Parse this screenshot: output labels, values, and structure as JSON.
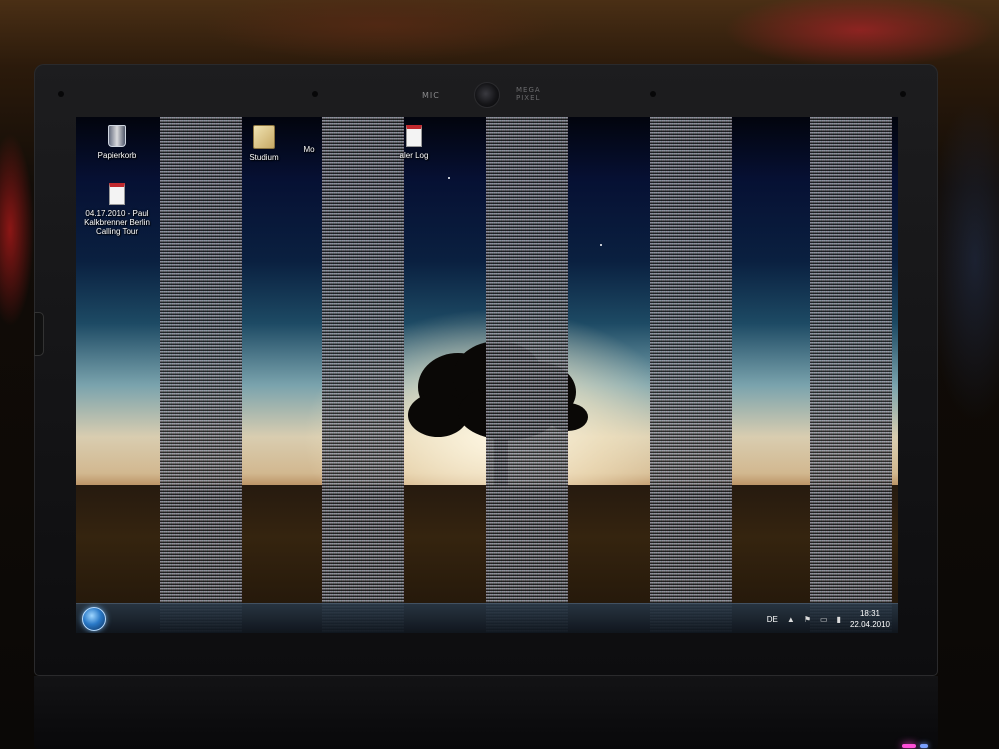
{
  "bezel": {
    "mic_label": "MIC",
    "mega_pixel_label_line1": "MEGA",
    "mega_pixel_label_line2": "PIXEL"
  },
  "desktop": {
    "icons": [
      {
        "label": "Papierkorb",
        "icon": "recycle-bin-icon"
      },
      {
        "label": "Studium",
        "icon": "folder-icon"
      },
      {
        "label": "Mo",
        "icon": "folder-icon"
      },
      {
        "label": "aler Log",
        "icon": "document-icon"
      },
      {
        "label": "04.17.2010 - Paul Kalkbrenner Berlin Calling Tour",
        "icon": "document-icon"
      }
    ]
  },
  "taskbar": {
    "language": "DE",
    "time": "18:31",
    "date": "22.04.2010"
  },
  "colors": {
    "led_pink": "#ff4fd8",
    "led_blue": "#7aa0ff"
  }
}
